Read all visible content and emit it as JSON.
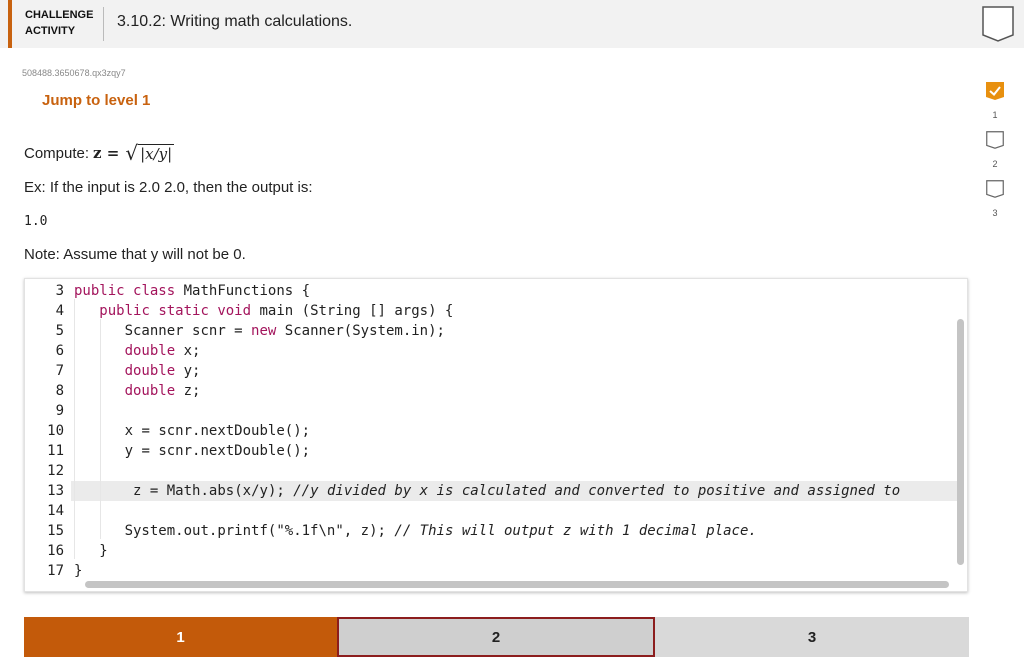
{
  "header": {
    "badge_line1": "CHALLENGE",
    "badge_line2": "ACTIVITY",
    "title": "3.10.2: Writing math calculations."
  },
  "activity_id": "508488.3650678.qx3zqy7",
  "jump_label": "Jump to level 1",
  "prompt": {
    "compute_label": "Compute:",
    "formula_lhs": "z =",
    "formula_radicand": "|x/y|",
    "example": "Ex: If the input is 2.0 2.0, then the output is:",
    "output": "1.0",
    "note": "Note: Assume that y will not be 0."
  },
  "code_lines": [
    {
      "num": "3",
      "text": "public class MathFunctions {"
    },
    {
      "num": "4",
      "text": "   public static void main (String [] args) {"
    },
    {
      "num": "5",
      "text": "      Scanner scnr = new Scanner(System.in);"
    },
    {
      "num": "6",
      "text": "      double x;"
    },
    {
      "num": "7",
      "text": "      double y;"
    },
    {
      "num": "8",
      "text": "      double z;"
    },
    {
      "num": "9",
      "text": ""
    },
    {
      "num": "10",
      "text": "      x = scnr.nextDouble();"
    },
    {
      "num": "11",
      "text": "      y = scnr.nextDouble();"
    },
    {
      "num": "12",
      "text": ""
    },
    {
      "num": "13",
      "text": "       z = Math.abs(x/y); //y divided by x is calculated and converted to positive and assigned to"
    },
    {
      "num": "14",
      "text": ""
    },
    {
      "num": "15",
      "text": "      System.out.printf(\"%.1f\\n\", z); // This will output z with 1 decimal place."
    },
    {
      "num": "16",
      "text": "   }"
    },
    {
      "num": "17",
      "text": "}"
    }
  ],
  "levels": [
    {
      "num": "1",
      "status": "completed"
    },
    {
      "num": "2",
      "status": "pending"
    },
    {
      "num": "3",
      "status": "pending"
    }
  ],
  "tabs": [
    {
      "label": "1"
    },
    {
      "label": "2"
    },
    {
      "label": "3"
    }
  ],
  "colors": {
    "accent": "#c8620f",
    "keyword": "#a3145c",
    "active_tab_border": "#8c1d1d"
  },
  "icons": {
    "bookmark": "bookmark-icon",
    "level_check": "checkmark-icon"
  }
}
